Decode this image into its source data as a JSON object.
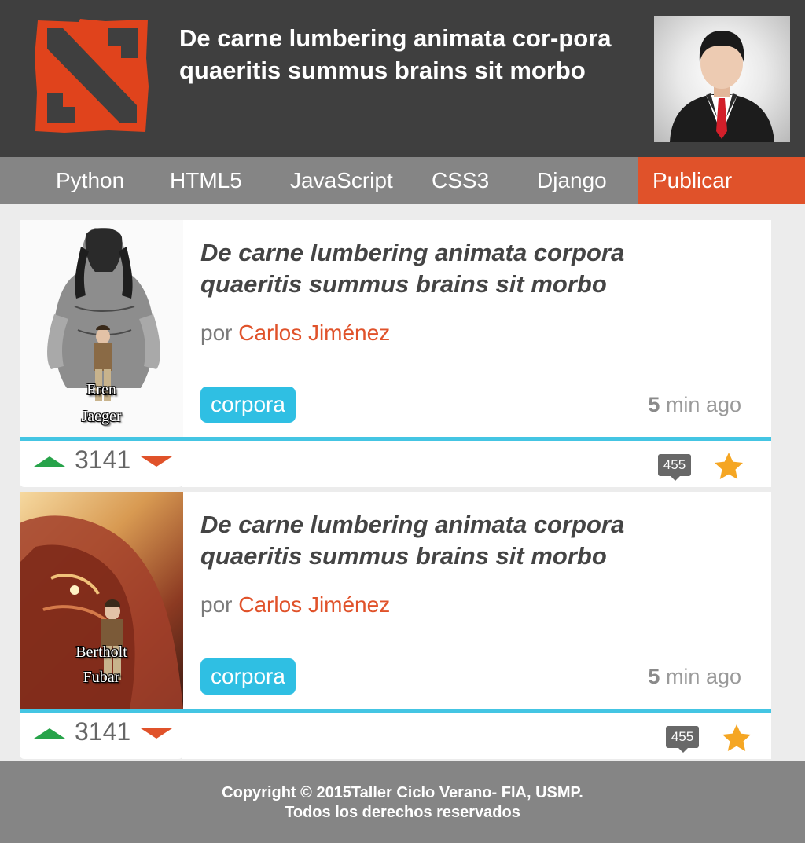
{
  "header": {
    "title": "De carne lumbering animata cor-pora quaeritis summus brains sit morbo",
    "logo_icon": "dota-logo-icon",
    "avatar_icon": "businessman-avatar-icon"
  },
  "nav": {
    "items": [
      "Python",
      "HTML5",
      "JavaScript",
      "CSS3",
      "Django"
    ],
    "publish": "Publicar"
  },
  "posts": [
    {
      "thumbnail_caption": [
        "Eren",
        "Jaeger"
      ],
      "title": "De carne lumbering animata corpora quaeritis summus brains sit morbo",
      "by": "por",
      "author": "Carlos Jiménez",
      "tag": "corpora",
      "time_value": "5",
      "time_unit": "min ago",
      "score": "3141",
      "comments": "455"
    },
    {
      "thumbnail_caption": [
        "Bertholt",
        "Fubar"
      ],
      "title": "De carne lumbering animata corpora quaeritis summus brains sit morbo",
      "by": "por",
      "author": "Carlos Jiménez",
      "tag": "corpora",
      "time_value": "5",
      "time_unit": "min ago",
      "score": "3141",
      "comments": "455"
    }
  ],
  "footer": {
    "line1": "Copyright © 2015Taller Ciclo Verano- FIA, USMP.",
    "line2": "Todos los derechos reservados"
  },
  "colors": {
    "header_bg": "#3f3f3f",
    "nav_bg": "#858585",
    "accent": "#e0522a",
    "tag": "#2fbfe3",
    "divider": "#44c5e3",
    "upvote": "#27a34a",
    "star": "#f5a623"
  }
}
